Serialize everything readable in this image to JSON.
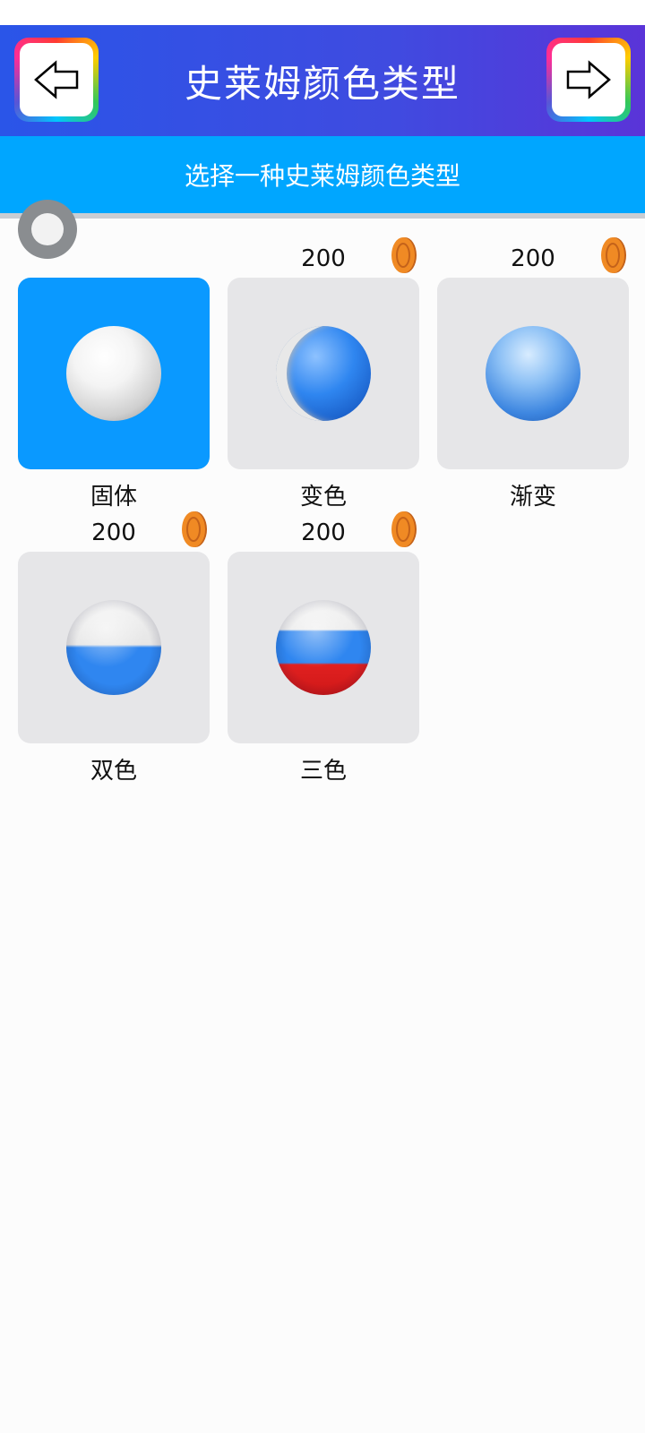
{
  "header": {
    "title": "史莱姆颜色类型",
    "back_icon": "arrow-left-icon",
    "forward_icon": "arrow-right-icon"
  },
  "subheader": {
    "text": "选择一种史莱姆颜色类型"
  },
  "colors": {
    "header_start": "#2a55e8",
    "header_end": "#5a34d8",
    "subheader": "#00a6ff",
    "selected_tile": "#0a99ff",
    "tile": "#e6e6e8",
    "coin": "#f08a24"
  },
  "types": [
    {
      "label": "固体",
      "price": "",
      "selected": true,
      "ball": "white"
    },
    {
      "label": "变色",
      "price": "200",
      "selected": false,
      "ball": "color-changing"
    },
    {
      "label": "渐变",
      "price": "200",
      "selected": false,
      "ball": "gradient"
    },
    {
      "label": "双色",
      "price": "200",
      "selected": false,
      "ball": "two-color"
    },
    {
      "label": "三色",
      "price": "200",
      "selected": false,
      "ball": "three-color"
    }
  ]
}
